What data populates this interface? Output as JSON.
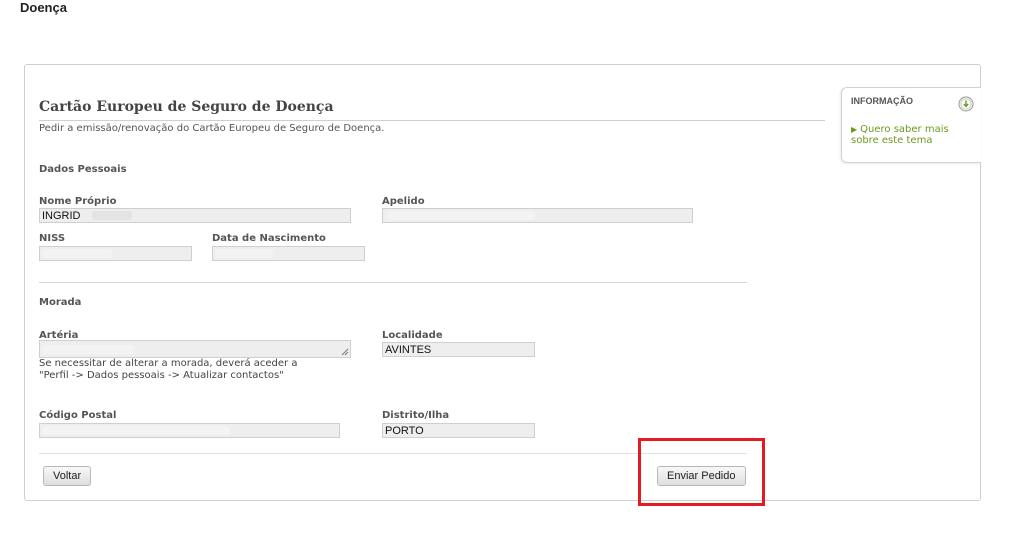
{
  "page": {
    "heading": "Doença"
  },
  "form": {
    "title": "Cartão Europeu de Seguro de Doença",
    "subtitle": "Pedir a emissão/renovação do Cartão Europeu de Seguro de Doença."
  },
  "dados_pessoais": {
    "section_label": "Dados Pessoais",
    "nome_proprio": {
      "label": "Nome Próprio",
      "value": "INGRID"
    },
    "apelido": {
      "label": "Apelido",
      "value": ""
    },
    "niss": {
      "label": "NISS",
      "value": ""
    },
    "data_nascimento": {
      "label": "Data de Nascimento",
      "value": ""
    }
  },
  "morada": {
    "section_label": "Morada",
    "arteria": {
      "label": "Artéria",
      "value": ""
    },
    "helper_line1": "Se necessitar de alterar a morada, deverá aceder a",
    "helper_line2": "\"Perfil -> Dados pessoais -> Atualizar contactos\"",
    "localidade": {
      "label": "Localidade",
      "value": "AVINTES"
    },
    "codigo_postal": {
      "label": "Código Postal",
      "value": ""
    },
    "distrito": {
      "label": "Distrito/Ilha",
      "value": "PORTO"
    }
  },
  "actions": {
    "back_label": "Voltar",
    "submit_label": "Enviar Pedido"
  },
  "info_panel": {
    "title": "INFORMAÇÃO",
    "link_text": "Quero saber mais sobre este tema",
    "icon": "info-download-icon"
  },
  "colors": {
    "link_green": "#6a9a1f",
    "highlight_red": "#e31b23",
    "field_bg": "#eeeeee"
  }
}
